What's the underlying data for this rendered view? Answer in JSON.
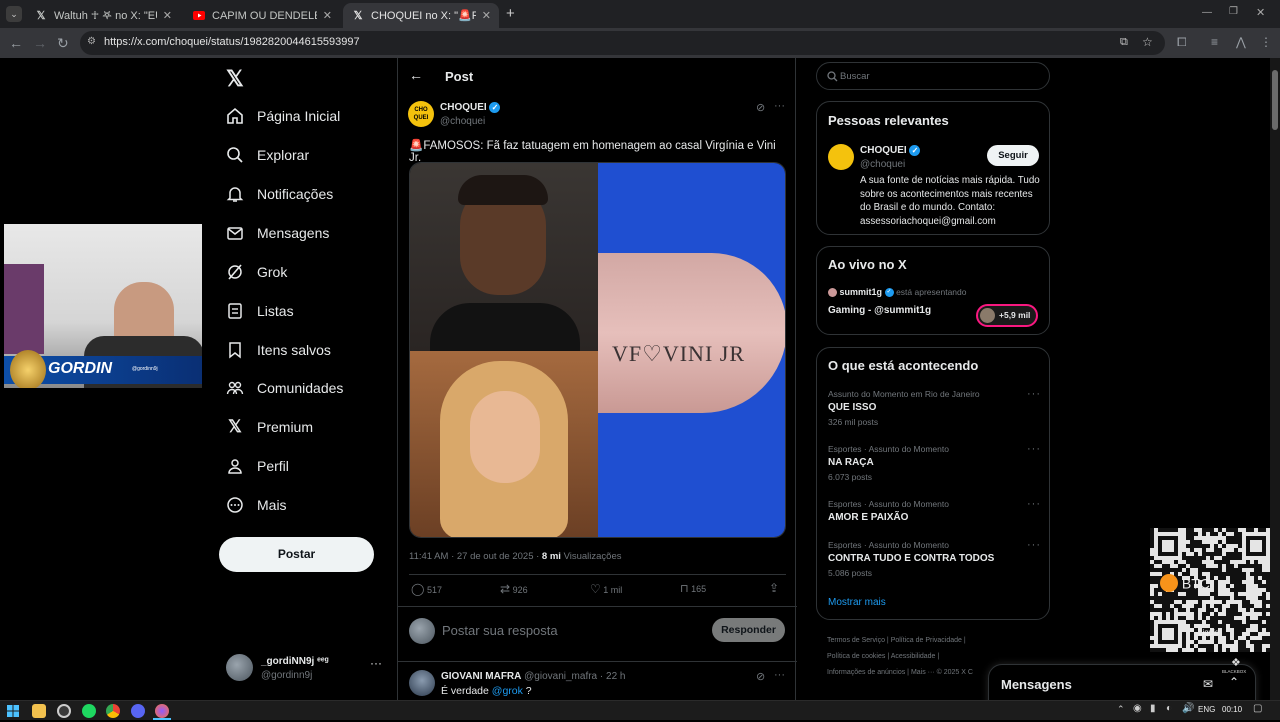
{
  "browser": {
    "tabs": [
      {
        "title": "Waltuh ☥ 𖤐 no X: \"EU AMALDIÇ",
        "icon": "x-logo-icon"
      },
      {
        "title": "CAPIM OU DENDELE PODEM TE",
        "icon": "youtube-icon"
      },
      {
        "title": "CHOQUEI no X: \"🚨FAMOSOS:",
        "icon": "x-logo-icon"
      }
    ],
    "new_tab": "+",
    "url": "https://x.com/choquei/status/1982820044615593997"
  },
  "sidebar": {
    "items": [
      {
        "label": "Página Inicial",
        "icon": "home-icon"
      },
      {
        "label": "Explorar",
        "icon": "search-icon"
      },
      {
        "label": "Notificações",
        "icon": "bell-icon"
      },
      {
        "label": "Mensagens",
        "icon": "mail-icon"
      },
      {
        "label": "Grok",
        "icon": "grok-icon"
      },
      {
        "label": "Listas",
        "icon": "list-icon"
      },
      {
        "label": "Itens salvos",
        "icon": "bookmark-icon"
      },
      {
        "label": "Comunidades",
        "icon": "people-icon"
      },
      {
        "label": "Premium",
        "icon": "x-logo-icon"
      },
      {
        "label": "Perfil",
        "icon": "person-icon"
      },
      {
        "label": "Mais",
        "icon": "more-circle-icon"
      }
    ],
    "post_button": "Postar",
    "account": {
      "name": "_gordiNN9j ᵉᵉᵍ",
      "handle": "@gordinn9j"
    }
  },
  "webcam": {
    "banner": "GORDIN",
    "small": "@gordinn9j"
  },
  "post": {
    "header": "Post",
    "author": {
      "name": "CHOQUEI",
      "handle": "@choquei",
      "avatar_text": "CHO QUEI"
    },
    "text": "🚨FAMOSOS: Fã faz tatuagem em homenagem ao casal Virgínia e Vini Jr.",
    "tattoo_text": "VF♡VINI JR",
    "time": "11:41 AM · 27 de out de 2025 · ",
    "views_count": "8 mi",
    "views_label": " Visualizações",
    "stats": {
      "replies": "517",
      "reposts": "926",
      "likes": "1 mil",
      "bookmarks": "165"
    },
    "reply_placeholder": "Postar sua resposta",
    "reply_button": "Responder"
  },
  "reply": {
    "name": "GIOVANI MAFRA",
    "handle": "@giovani_mafra",
    "time": "· 22 h",
    "text_before": "É verdade ",
    "mention": "@grok",
    "text_after": " ?"
  },
  "right": {
    "search_placeholder": "Buscar",
    "relevant": {
      "title": "Pessoas relevantes",
      "name": "CHOQUEI",
      "handle": "@choquei",
      "follow": "Seguir",
      "bio": "A sua fonte de notícias mais rápida. Tudo sobre os acontecimentos mais recentes do Brasil e do mundo. Contato: assessoriachoquei@gmail.com"
    },
    "live": {
      "title": "Ao vivo no X",
      "user": "summit1g",
      "status": "está apresentando",
      "stream": "Gaming - @summit1g",
      "count": "+5,9 mil"
    },
    "trends": {
      "title": "O que está acontecendo",
      "items": [
        {
          "category": "Assunto do Momento em Rio de Janeiro",
          "name": "QUE ISSO",
          "count": "326 mil posts"
        },
        {
          "category": "Esportes · Assunto do Momento",
          "name": "NA RAÇA",
          "count": "6.073 posts"
        },
        {
          "category": "Esportes · Assunto do Momento",
          "name": "AMOR E PAIXÃO",
          "count": ""
        },
        {
          "category": "Esportes · Assunto do Momento",
          "name": "CONTRA TUDO E CONTRA TODOS",
          "count": "5.086 posts"
        }
      ],
      "show_more": "Mostrar mais"
    },
    "footer": [
      "Termos de Serviço",
      "Política de Privacidade",
      "Política de cookies",
      "Acessibilidade",
      "Informações de anúncios",
      "Mais ···",
      "© 2025 X C"
    ],
    "messages": "Mensagens"
  },
  "overlay": {
    "btc": "BTC",
    "liquid": "Liquid",
    "brand": "BLACKBOX"
  },
  "taskbar": {
    "lang": "ENG",
    "time": "00:10"
  }
}
